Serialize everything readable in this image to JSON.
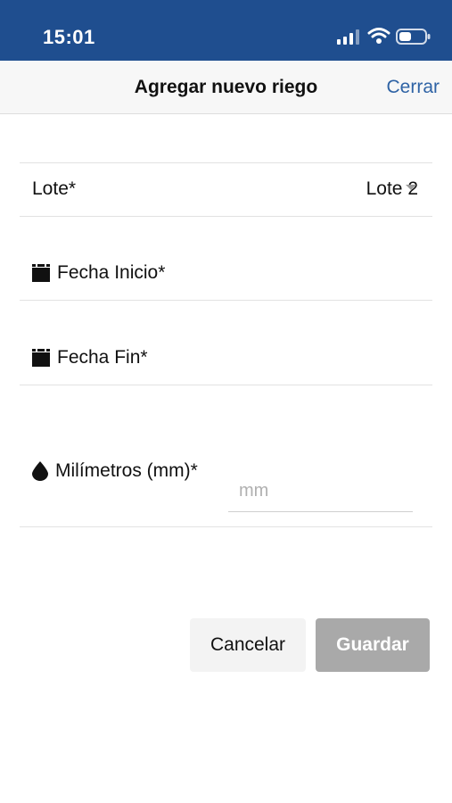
{
  "status_bar": {
    "time": "15:01"
  },
  "header": {
    "title": "Agregar nuevo riego",
    "close_label": "Cerrar"
  },
  "form": {
    "lote": {
      "label": "Lote*",
      "value": "Lote 2"
    },
    "fecha_inicio": {
      "label": "Fecha Inicio*"
    },
    "fecha_fin": {
      "label": "Fecha Fin*"
    },
    "milimetros": {
      "label": "Milímetros (mm)*",
      "placeholder": "mm",
      "value": ""
    }
  },
  "actions": {
    "cancel_label": "Cancelar",
    "save_label": "Guardar"
  },
  "colors": {
    "status_bar": "#1f4e8f",
    "link": "#2f63a5",
    "disabled_button": "#a9a9a9"
  },
  "icons": [
    "signal-icon",
    "wifi-icon",
    "battery-icon",
    "calendar-icon",
    "water-drop-icon",
    "caret-down-icon"
  ]
}
